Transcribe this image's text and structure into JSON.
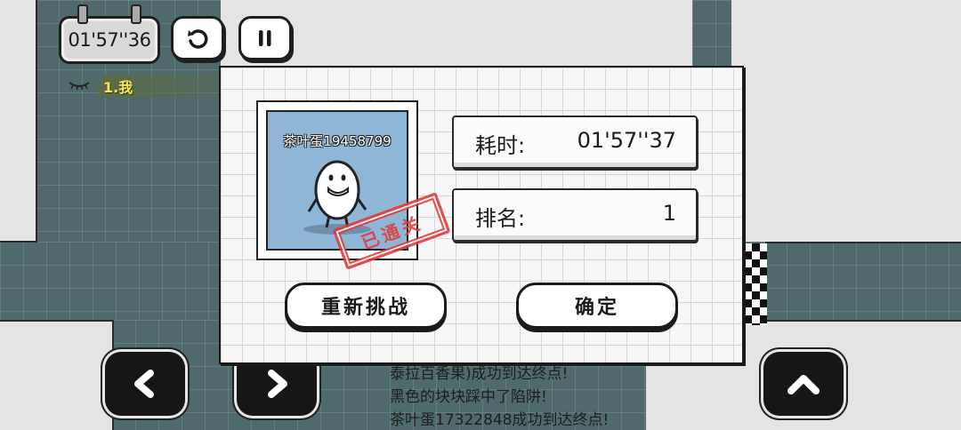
{
  "hud": {
    "timer": "01'57''36",
    "restart_icon": "restart-icon",
    "pause_icon": "pause-icon"
  },
  "leaderboard": {
    "entries": [
      {
        "label": "1.我"
      }
    ],
    "icon": "eye-closed-icon"
  },
  "result_dialog": {
    "player_name": "茶叶蛋19458799",
    "stamp_text": "已通关",
    "time_label": "耗时:",
    "time_value": "01'57''37",
    "rank_label": "排名:",
    "rank_value": "1",
    "retry_button": "重新挑战",
    "confirm_button": "确定"
  },
  "chat_log": [
    "泰拉百香果)成功到达终点!",
    "黑色的块块踩中了陷阱!",
    "茶叶蛋17322848成功到达终点!"
  ],
  "controls": {
    "left_icon": "chevron-left-icon",
    "right_icon": "chevron-right-icon",
    "jump_icon": "chevron-up-icon"
  },
  "colors": {
    "floor": "#4f6a6c",
    "wall": "#e4e4e4",
    "stamp": "#e23b3b",
    "rank_highlight": "#f7e64a",
    "photo_bg": "#8fb6d7"
  }
}
